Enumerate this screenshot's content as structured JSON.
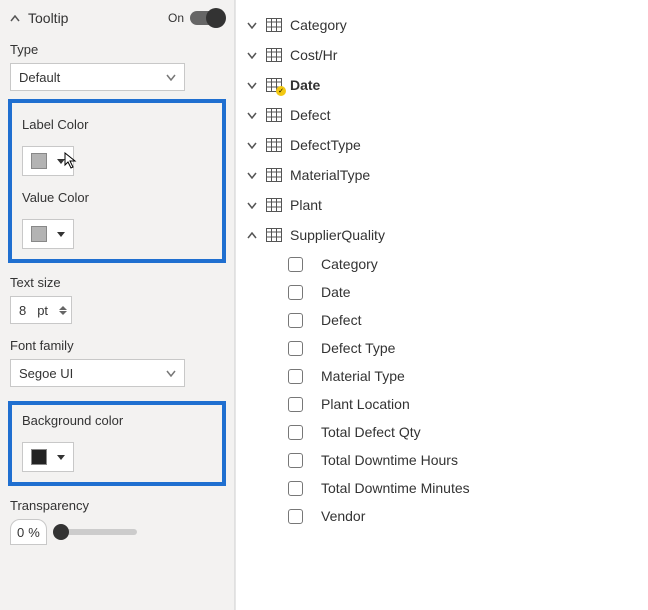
{
  "format": {
    "section_title": "Tooltip",
    "toggle_label": "On",
    "type_label": "Type",
    "type_value": "Default",
    "label_color_label": "Label Color",
    "value_color_label": "Value Color",
    "text_size_label": "Text size",
    "text_size_value": "8",
    "text_size_unit": "pt",
    "font_family_label": "Font family",
    "font_family_value": "Segoe UI",
    "background_color_label": "Background color",
    "transparency_label": "Transparency",
    "transparency_value": "0",
    "transparency_unit": "%"
  },
  "fields": {
    "tables": [
      {
        "name": "Category",
        "expanded": false
      },
      {
        "name": "Cost/Hr",
        "expanded": false
      },
      {
        "name": "Date",
        "expanded": false,
        "bold": true,
        "badge": true
      },
      {
        "name": "Defect",
        "expanded": false
      },
      {
        "name": "DefectType",
        "expanded": false
      },
      {
        "name": "MaterialType",
        "expanded": false
      },
      {
        "name": "Plant",
        "expanded": false
      },
      {
        "name": "SupplierQuality",
        "expanded": true,
        "columns": [
          "Category",
          "Date",
          "Defect",
          "Defect Type",
          "Material Type",
          "Plant Location",
          "Total Defect Qty",
          "Total Downtime Hours",
          "Total Downtime Minutes",
          "Vendor"
        ]
      }
    ]
  }
}
